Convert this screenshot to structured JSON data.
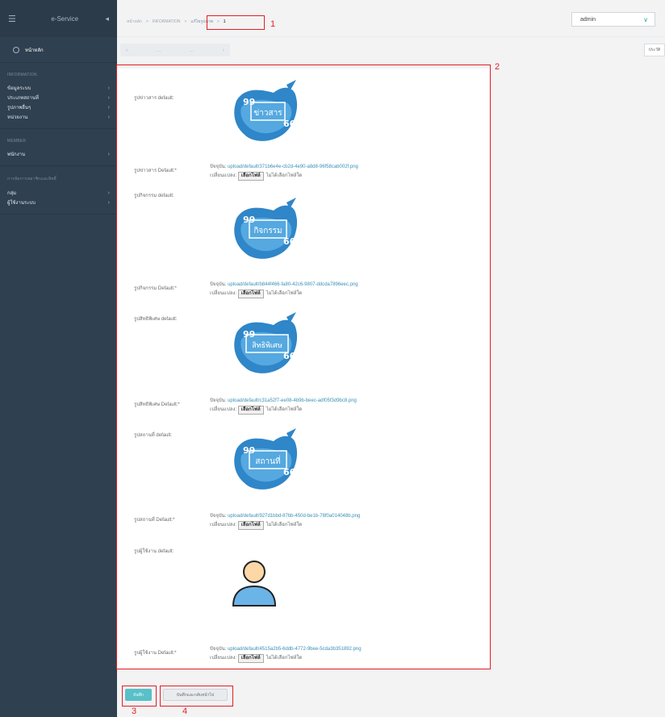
{
  "sidebar": {
    "brand": "e-Service",
    "home": "หน้าหลัก",
    "sections": [
      {
        "title": "INFORMATION",
        "items": [
          "ข้อมูลระบบ",
          "ประเภทสถานที่",
          "รูปภาพอื่นๆ",
          "หน่วยงาน"
        ]
      },
      {
        "title": "MEMBER",
        "items": [
          "พนักงาน"
        ]
      },
      {
        "title": "การจัดการสมาชิกและสิทธิ์",
        "items": [
          "กลุ่ม",
          "ผู้ใช้งานระบบ"
        ]
      }
    ]
  },
  "breadcrumb": {
    "home": "หน้าหลัก",
    "section": "INFORMATION",
    "current": "แก้ไขรูปภาพ",
    "page": "1"
  },
  "admin": {
    "user": "admin"
  },
  "subnav": {
    "history": "ประวัติ"
  },
  "rows": [
    {
      "label": "รูปข่าวสาร default:",
      "field": "รูปข่าวสาร Default:*",
      "caption": "ข่าวสาร",
      "current_prefix": "ปัจจุบัน: ",
      "path": "upload/default/371b6e4e-cb2d-4e90-a8d8-96f58cab002f.png",
      "change": "เปลี่ยนแปลง: ",
      "file_btn": "เลือกไฟล์",
      "no_file": "ไม่ได้เลือกไฟล์ใด"
    },
    {
      "label": "รูปกิจกรรม default:",
      "field": "รูปกิจกรรม Default:*",
      "caption": "กิจกรรม",
      "current_prefix": "ปัจจุบัน: ",
      "path": "upload/default/b844f466-fa80-42c6-9807-ddcda7896eec.png",
      "change": "เปลี่ยนแปลง: ",
      "file_btn": "เลือกไฟล์",
      "no_file": "ไม่ได้เลือกไฟล์ใด"
    },
    {
      "label": "รูปสิทธิพิเศษ default:",
      "field": "รูปสิทธิพิเศษ Default:*",
      "caption": "สิทธิพิเศษ",
      "current_prefix": "ปัจจุบัน: ",
      "path": "upload/default/c31a52f7-ee08-4b9b-beec-adf05f3d9bc8.png",
      "change": "เปลี่ยนแปลง: ",
      "file_btn": "เลือกไฟล์",
      "no_file": "ไม่ได้เลือกไฟล์ใด"
    },
    {
      "label": "รูปสถานที่ default:",
      "field": "รูปสถานที่ Default:*",
      "caption": "สถานที่",
      "current_prefix": "ปัจจุบัน: ",
      "path": "upload/default/927d1bbd-87bb-450d-be1b-78f0a014048b.png",
      "change": "เปลี่ยนแปลง: ",
      "file_btn": "เลือกไฟล์",
      "no_file": "ไม่ได้เลือกไฟล์ใด"
    },
    {
      "label": "รูปผู้ใช้งาน default:",
      "field": "รูปผู้ใช้งาน Default:*",
      "caption": "",
      "current_prefix": "ปัจจุบัน: ",
      "path": "upload/default/4515a2b5-6ddb-4772-9bee-5cda3b351892.png",
      "change": "เปลี่ยนแปลง: ",
      "file_btn": "เลือกไฟล์",
      "no_file": "ไม่ได้เลือกไฟล์ใด"
    }
  ],
  "buttons": {
    "save": "บันทึก",
    "save_back": "บันทึกและกลับหน้าไป"
  },
  "annotations": [
    "1",
    "2",
    "3",
    "4"
  ],
  "colors": {
    "sidebar": "#2f4050",
    "accent": "#1ab394",
    "save": "#58c0c8",
    "link": "#3a8fb7",
    "annotation": "#e31e24"
  }
}
